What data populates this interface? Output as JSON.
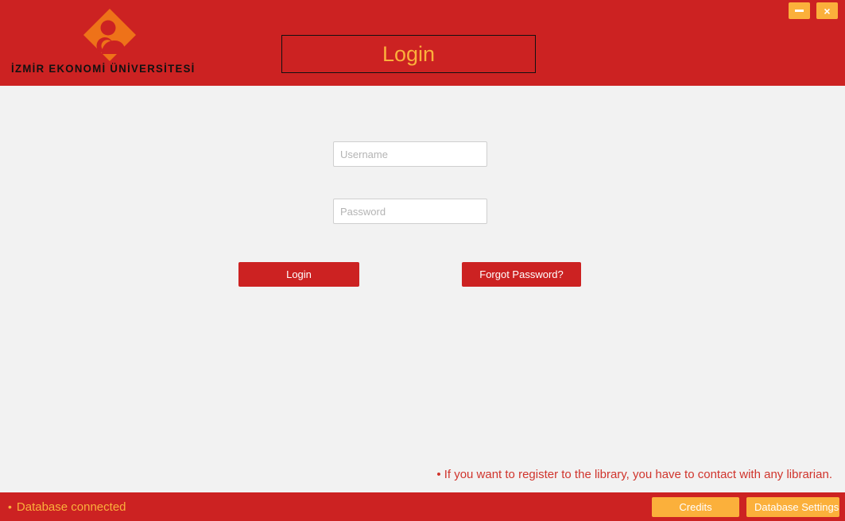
{
  "window": {
    "title": "Login",
    "controls": [
      {
        "name": "minimize",
        "glyph": "–",
        "label": "Minimize"
      },
      {
        "name": "close",
        "glyph": "×",
        "label": "Close"
      }
    ]
  },
  "header": {
    "brand_name": "İZMİR EKONOMİ ÜNİVERSİTESİ",
    "logo_icon": "izmir-ekonomi-diamond-logo",
    "title": "Login"
  },
  "form": {
    "username": {
      "value": "",
      "placeholder": "Username"
    },
    "password": {
      "value": "",
      "placeholder": "Password"
    },
    "login_label": "Login",
    "forgot_password_label": "Forgot Password?"
  },
  "notice": {
    "bullet": "•",
    "text": "If you want to register to the library, you have to contact with any librarian."
  },
  "statusbar": {
    "bullet": "•",
    "db_status": "Database connected",
    "credits_label": "Credits",
    "database_settings_label": "Database Settings"
  },
  "colors": {
    "brand_red": "#cc2222",
    "brand_gold": "#fbb03b",
    "body_background": "#f2f2f2",
    "notice_red": "#d0342c",
    "button_text": "#ffffff"
  }
}
